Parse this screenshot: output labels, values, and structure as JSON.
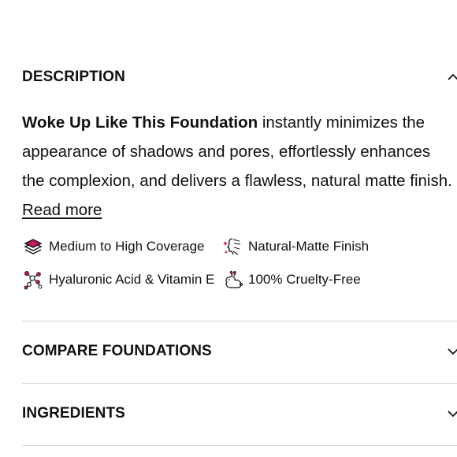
{
  "description": {
    "title": "DESCRIPTION",
    "product_name": "Woke Up Like This Foundation",
    "body": " instantly minimizes the appearance of shadows and pores, effortlessly enhances the complexion, and delivers a flawless, natural matte finish. ",
    "read_more": "Read more",
    "toggle_icon": "chevron-up-icon",
    "features": [
      {
        "label": "Medium to High Coverage",
        "icon": "layers-icon"
      },
      {
        "label": "Natural-Matte Finish",
        "icon": "face-sparkle-icon"
      },
      {
        "label": "Hyaluronic Acid & Vitamin E",
        "icon": "molecule-icon"
      },
      {
        "label": "100% Cruelty-Free",
        "icon": "bunny-icon"
      }
    ]
  },
  "sections": {
    "compare": {
      "title": "COMPARE FOUNDATIONS",
      "toggle_icon": "chevron-down-icon"
    },
    "ingredients": {
      "title": "INGREDIENTS",
      "toggle_icon": "chevron-down-icon"
    }
  },
  "colors": {
    "accent": "#c2185b",
    "text": "#111111",
    "divider": "#d9d9d9"
  }
}
